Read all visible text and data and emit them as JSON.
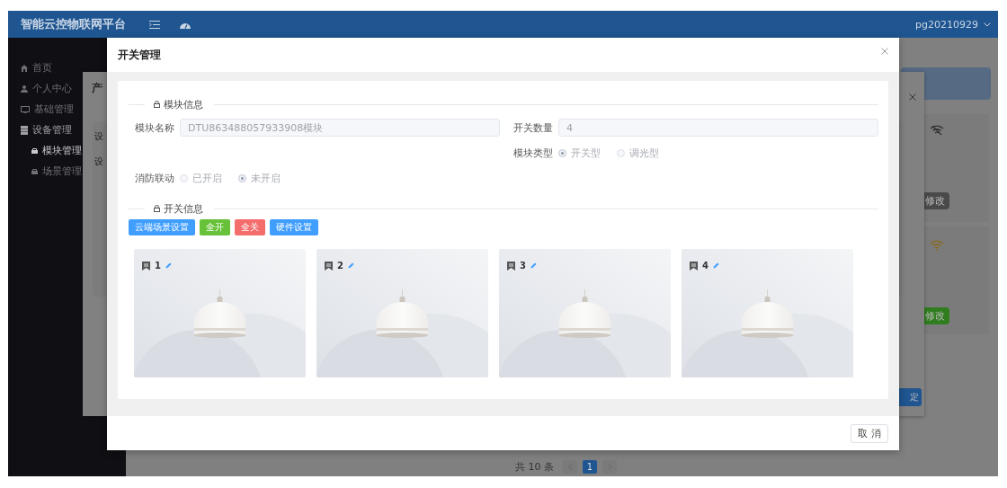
{
  "header": {
    "title": "智能云控物联网平台",
    "user": "pg20210929"
  },
  "sidebar": {
    "items": [
      {
        "label": "首页",
        "selected": false
      },
      {
        "label": "个人中心",
        "selected": false
      },
      {
        "label": "基础管理",
        "selected": false
      },
      {
        "label": "设备管理",
        "selected": false,
        "children": [
          {
            "label": "模块管理",
            "selected": true
          },
          {
            "label": "场景管理",
            "selected": false
          }
        ]
      }
    ]
  },
  "background": {
    "dialog_title": "产",
    "labels": [
      "设",
      "设"
    ],
    "edit_buttons": [
      {
        "label": "修改",
        "kind": "dark"
      },
      {
        "label": "修改",
        "kind": "green"
      }
    ],
    "confirm": "定",
    "pagination": {
      "total": "共 10 条",
      "pages": [
        {
          "label": "1",
          "selected": true
        }
      ]
    }
  },
  "dialog": {
    "title": "开关管理",
    "module_section": "模块信息",
    "form_rows": [
      {
        "left": {
          "kind": "input",
          "label": "模块名称",
          "value": "DTU863488057933908模块"
        },
        "right": {
          "kind": "input",
          "label": "开关数量",
          "value": "4"
        }
      },
      {
        "right": {
          "kind": "radio",
          "label": "模块类型",
          "options": [
            {
              "label": "开关型",
              "selected": true
            },
            {
              "label": "调光型",
              "selected": false
            }
          ]
        }
      },
      {
        "left": {
          "kind": "radio",
          "label": "消防联动",
          "options": [
            {
              "label": "已开启",
              "selected": false
            },
            {
              "label": "未开启",
              "selected": true
            }
          ]
        }
      }
    ],
    "switch_section": "开关信息",
    "buttons": [
      {
        "label": "云端场景设置",
        "kind": "primary"
      },
      {
        "label": "全开",
        "kind": "success"
      },
      {
        "label": "全关",
        "kind": "danger"
      },
      {
        "label": "硬件设置",
        "kind": "primary"
      }
    ],
    "switches": [
      {
        "name": "1"
      },
      {
        "name": "2"
      },
      {
        "name": "3"
      },
      {
        "name": "4"
      }
    ],
    "cancel": "取 消"
  }
}
